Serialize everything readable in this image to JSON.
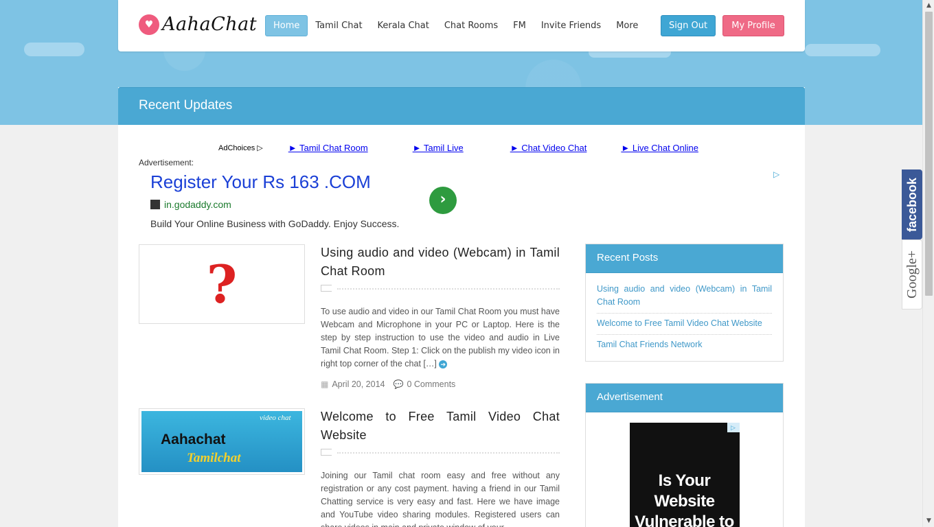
{
  "header": {
    "logo_text": "AahaChat",
    "nav": [
      "Home",
      "Tamil Chat",
      "Kerala Chat",
      "Chat Rooms",
      "FM",
      "Invite Friends",
      "More"
    ],
    "sign_out": "Sign Out",
    "my_profile": "My Profile"
  },
  "banner": {
    "title": "Recent Updates"
  },
  "ad_bar": {
    "adchoices": "AdChoices ▷",
    "links": [
      "► Tamil Chat Room",
      "► Tamil Live",
      "► Chat Video Chat",
      "► Live Chat Online"
    ]
  },
  "ad": {
    "label": "Advertisement:",
    "title": "Register Your Rs 163 .COM",
    "domain": "in.godaddy.com",
    "description": "Build Your Online Business with GoDaddy. Enjoy Success."
  },
  "posts": [
    {
      "title": "Using audio and video (Webcam) in Tamil Chat Room",
      "excerpt": "To use audio and video in our Tamil Chat Room you must have Webcam and Microphone in your PC or Laptop. Here is the step by step instruction to use the video and audio in Live Tamil Chat Room. Step 1: Click on the publish my video icon in right top corner of the chat […]",
      "date": "April 20, 2014",
      "comments": "0 Comments"
    },
    {
      "title": "Welcome to Free Tamil Video Chat Website",
      "excerpt": "Joining our Tamil chat room easy and free without any registration or any cost payment. having a friend in our Tamil Chatting service is very easy and fast. Here we have image and YouTube video sharing modules. Registered users can share videos in main and private window of your",
      "thumb_text_1": "Aahachat",
      "thumb_text_2": "Tamilchat",
      "thumb_text_3": "video chat"
    }
  ],
  "sidebar": {
    "recent_posts_title": "Recent Posts",
    "recent_posts": [
      "Using audio and video (Webcam) in Tamil Chat Room",
      "Welcome to Free Tamil Video Chat Website",
      "Tamil Chat Friends Network"
    ],
    "advertisement_title": "Advertisement",
    "ad_text": "Is Your Website Vulnerable to SQL Injection"
  },
  "social": {
    "facebook": "facebook",
    "google": "Google+"
  }
}
